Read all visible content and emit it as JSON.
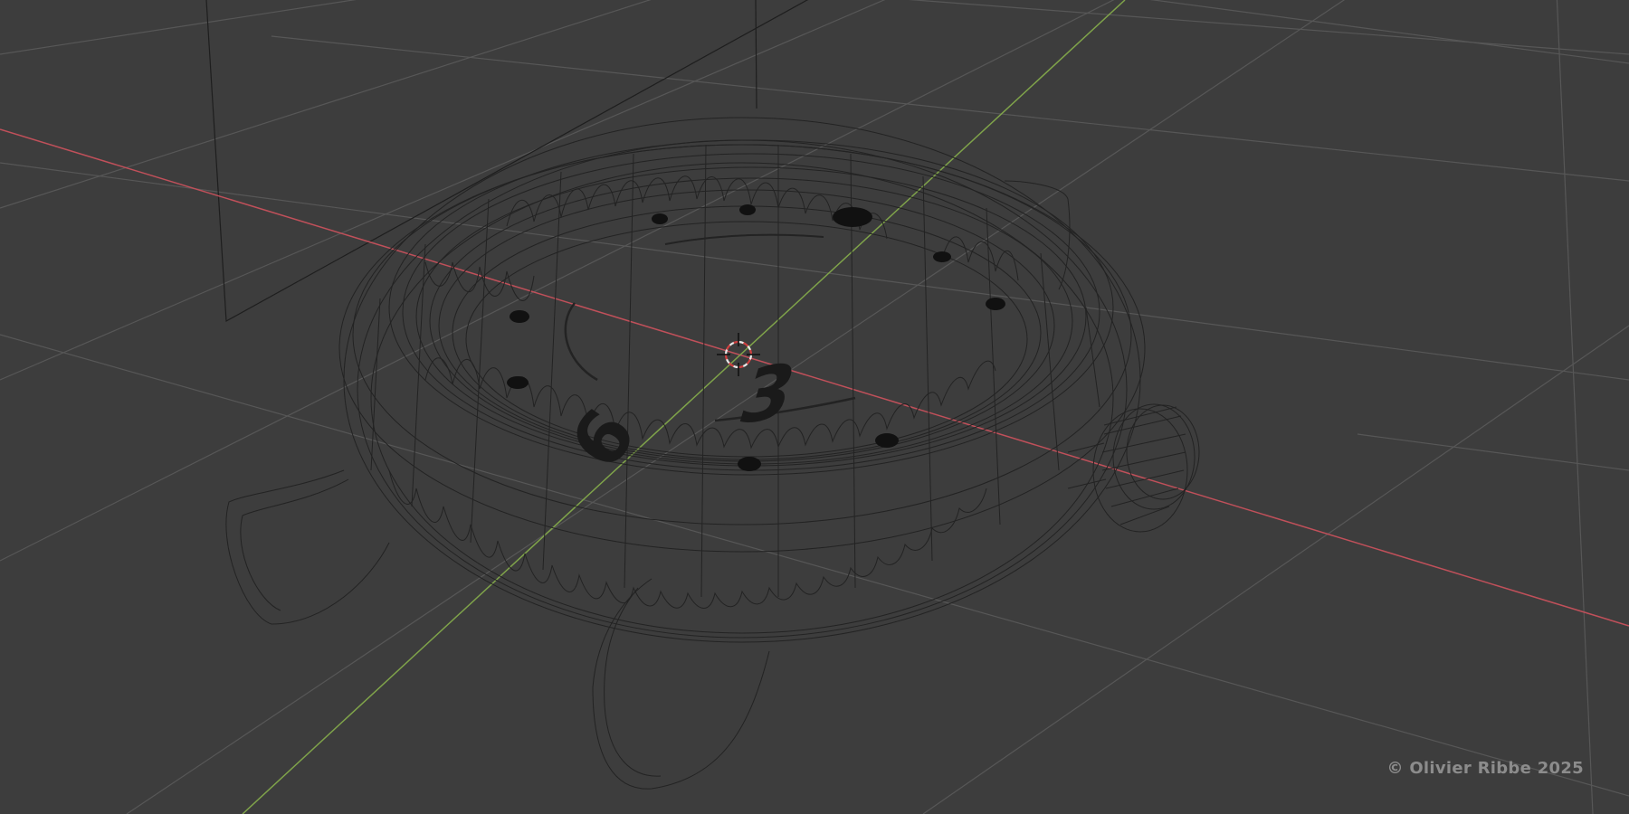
{
  "app": {
    "view": "3d-viewport",
    "shading_mode": "wireframe",
    "background_color": "#3d3d3d"
  },
  "axes": {
    "x_axis_color": "#c0505a",
    "y_axis_color": "#7fa34a",
    "grid_color": "#575757"
  },
  "object": {
    "subject": "watch-case",
    "dial_numerals": [
      "3",
      "6"
    ]
  },
  "watermark": {
    "text": "© Olivier Ribbe 2025"
  }
}
